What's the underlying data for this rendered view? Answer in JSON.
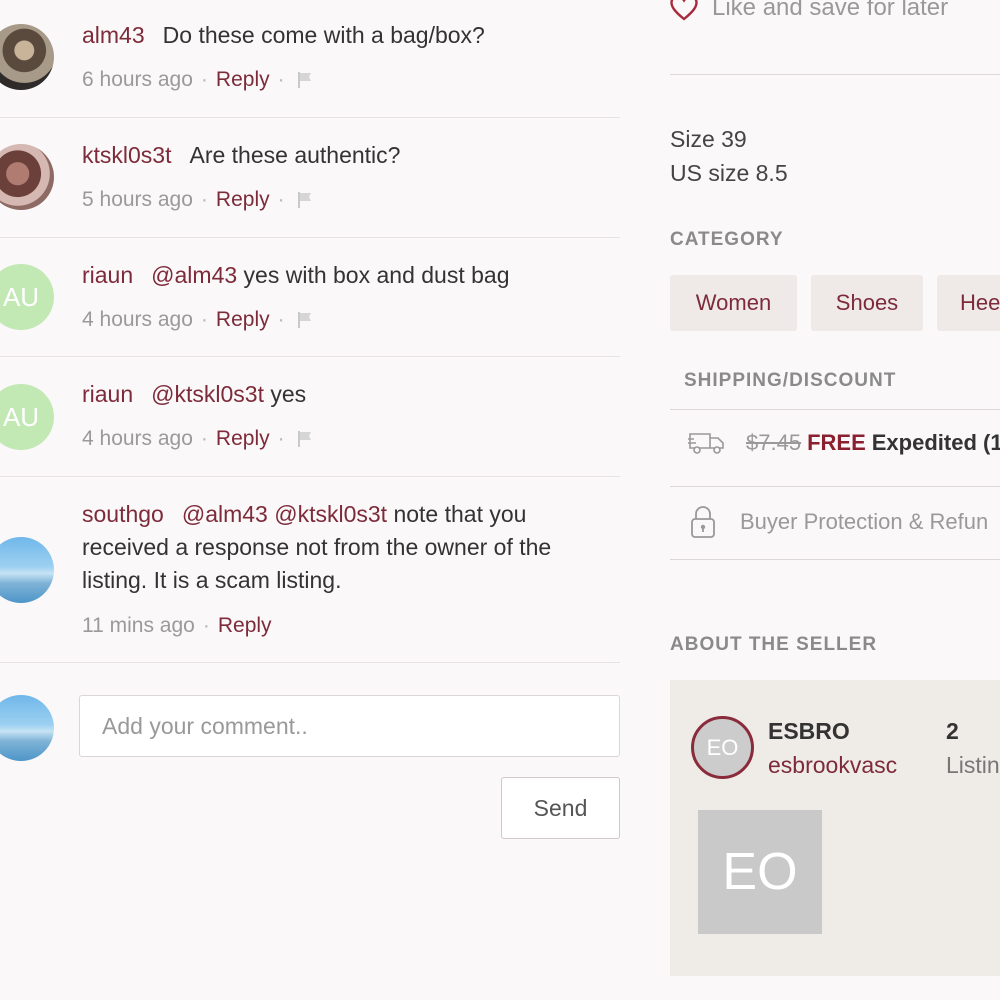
{
  "comments": [
    {
      "user": "alm43",
      "mention": "",
      "text": "Do these come with a bag/box?",
      "time": "6 hours ago",
      "reply": "Reply",
      "avatar": "photo"
    },
    {
      "user": "ktskl0s3t",
      "mention": "",
      "text": "Are these authentic?",
      "time": "5 hours ago",
      "reply": "Reply",
      "avatar": "photo"
    },
    {
      "user": "riaun",
      "mention": "@alm43",
      "text": "yes with box and dust bag",
      "time": "4 hours ago",
      "reply": "Reply",
      "avatar_initials": "AU"
    },
    {
      "user": "riaun",
      "mention": "@ktskl0s3t",
      "text": "yes",
      "time": "4 hours ago",
      "reply": "Reply",
      "avatar_initials": "AU"
    },
    {
      "user": "southgo",
      "mention": "@alm43 @ktskl0s3t",
      "text_line1": "note that you",
      "text_line2": "received a response not from the owner of the",
      "text_line3": "listing. It is a scam listing.",
      "time": "11 mins ago",
      "reply": "Reply",
      "avatar": "sky"
    }
  ],
  "comment_form": {
    "placeholder": "Add your comment..",
    "send_label": "Send"
  },
  "sidebar": {
    "like_label": "Like and save for later",
    "size": "Size 39",
    "us_size": "US size 8.5",
    "category_heading": "CATEGORY",
    "categories": [
      "Women",
      "Shoes",
      "Hee"
    ],
    "shipping_heading": "SHIPPING/DISCOUNT",
    "old_price": "$7.45",
    "free_label": "FREE",
    "shipping_type": "Expedited (1",
    "protection_label": "Buyer Protection & Refun",
    "about_heading": "ABOUT THE SELLER",
    "seller": {
      "initials": "EO",
      "name": "ESBRO",
      "handle": "esbrookvasc",
      "listings_count": "2",
      "listings_label": "Listin"
    }
  },
  "colors": {
    "accent": "#7d2b3a",
    "background": "#faf8f8",
    "chip_bg": "#efe9e8",
    "avatar_green": "#c2e8b4"
  }
}
